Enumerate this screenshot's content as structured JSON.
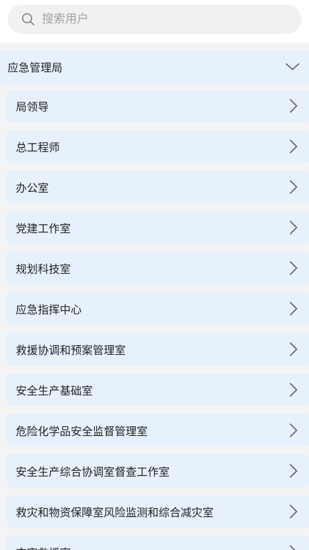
{
  "search": {
    "placeholder": "搜索用户"
  },
  "group": {
    "title": "应急管理局",
    "expanded_icon": "chevron-down-icon"
  },
  "departments": [
    "局领导",
    "总工程师",
    "办公室",
    "党建工作室",
    "规划科技室",
    "应急指挥中心",
    "救援协调和预案管理室",
    "安全生产基础室",
    "危险化学品安全监督管理室",
    "安全生产综合协调室督查工作室",
    "救灾和物资保障室风险监测和综合减灾室",
    "灾害救援室"
  ],
  "colors": {
    "row_background": "#e7f1fc",
    "list_background": "#f4f4f4",
    "search_background": "#f1f1f1",
    "placeholder_text": "#a2a2a2"
  }
}
